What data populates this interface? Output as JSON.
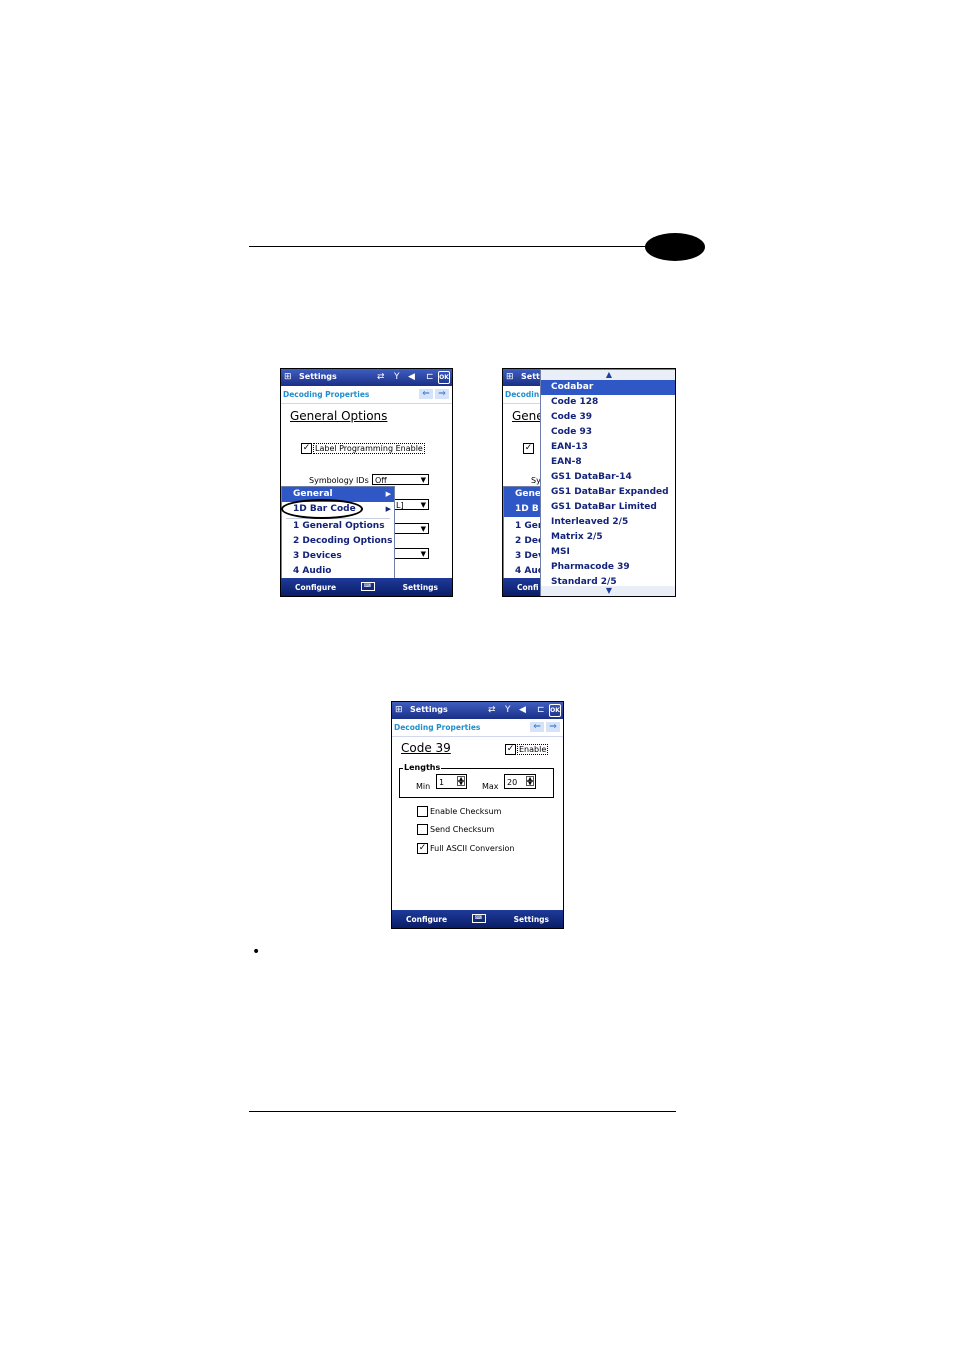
{
  "bullet": "•",
  "left_screen": {
    "title": "Settings",
    "status_icons": [
      "⇄",
      "Y",
      "◀",
      "⊏"
    ],
    "ok": "OK",
    "breadcrumb": "Decoding Properties",
    "nav_back": "⇐",
    "nav_fwd": "⇒",
    "heading": "General Options",
    "label_programming": "Label Programming Enable",
    "symbology_label": "Symbology IDs",
    "symbology_value": "Off",
    "partial_combo_text": "L]",
    "menu": [
      "General",
      "1D Bar Code",
      "1 General Options",
      "2 Decoding Options",
      "3 Devices",
      "4 Audio"
    ],
    "soft_left": "Configure",
    "soft_right": "Settings"
  },
  "right_screen": {
    "title_partial": "Sett",
    "breadcrumb_partial": "Decodin",
    "heading_partial": "Gene",
    "label_partial": "Sy",
    "menu_partial": [
      "Gene",
      "1D B",
      "1 Gen",
      "2 Dec",
      "3 Dev",
      "4 Aud"
    ],
    "soft_left_partial": "Confi",
    "list": [
      "Codabar",
      "Code 128",
      "Code 39",
      "Code 93",
      "EAN-13",
      "EAN-8",
      "GS1 DataBar-14",
      "GS1 DataBar Expanded",
      "GS1 DataBar Limited",
      "Interleaved 2/5",
      "Matrix 2/5",
      "MSI",
      "Pharmacode 39",
      "Standard 2/5"
    ],
    "scroll_up": "▲",
    "scroll_down": "▼"
  },
  "bottom_screen": {
    "title": "Settings",
    "breadcrumb": "Decoding Properties",
    "heading": "Code 39",
    "enable_label": "Enable",
    "lengths_label": "Lengths",
    "min_label": "Min",
    "min_value": "1",
    "max_label": "Max",
    "max_value": "20",
    "enable_checksum": "Enable Checksum",
    "send_checksum": "Send Checksum",
    "full_ascii": "Full ASCII Conversion",
    "soft_left": "Configure",
    "soft_right": "Settings"
  }
}
